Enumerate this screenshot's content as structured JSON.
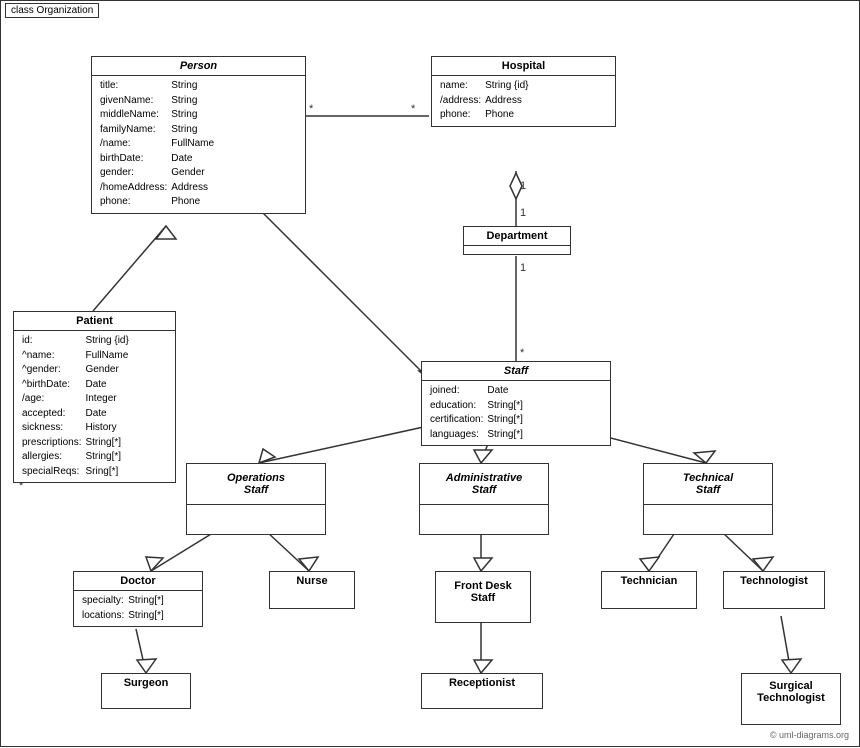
{
  "diagram": {
    "title": "class Organization",
    "classes": {
      "person": {
        "name": "Person",
        "italic": true,
        "attrs": [
          [
            "title:",
            "String"
          ],
          [
            "givenName:",
            "String"
          ],
          [
            "middleName:",
            "String"
          ],
          [
            "familyName:",
            "String"
          ],
          [
            "/name:",
            "FullName"
          ],
          [
            "birthDate:",
            "Date"
          ],
          [
            "gender:",
            "Gender"
          ],
          [
            "/homeAddress:",
            "Address"
          ],
          [
            "phone:",
            "Phone"
          ]
        ]
      },
      "hospital": {
        "name": "Hospital",
        "italic": false,
        "attrs": [
          [
            "name:",
            "String {id}"
          ],
          [
            "/address:",
            "Address"
          ],
          [
            "phone:",
            "Phone"
          ]
        ]
      },
      "department": {
        "name": "Department",
        "italic": false,
        "attrs": []
      },
      "staff": {
        "name": "Staff",
        "italic": true,
        "attrs": [
          [
            "joined:",
            "Date"
          ],
          [
            "education:",
            "String[*]"
          ],
          [
            "certification:",
            "String[*]"
          ],
          [
            "languages:",
            "String[*]"
          ]
        ]
      },
      "patient": {
        "name": "Patient",
        "italic": false,
        "attrs": [
          [
            "id:",
            "String {id}"
          ],
          [
            "^name:",
            "FullName"
          ],
          [
            "^gender:",
            "Gender"
          ],
          [
            "^birthDate:",
            "Date"
          ],
          [
            "/age:",
            "Integer"
          ],
          [
            "accepted:",
            "Date"
          ],
          [
            "sickness:",
            "History"
          ],
          [
            "prescriptions:",
            "String[*]"
          ],
          [
            "allergies:",
            "String[*]"
          ],
          [
            "specialReqs:",
            "Sring[*]"
          ]
        ]
      },
      "operations_staff": {
        "name": "Operations Staff",
        "italic": true
      },
      "administrative_staff": {
        "name": "Administrative Staff",
        "italic": true
      },
      "technical_staff": {
        "name": "Technical Staff",
        "italic": true
      },
      "doctor": {
        "name": "Doctor",
        "italic": false,
        "attrs": [
          [
            "specialty:",
            "String[*]"
          ],
          [
            "locations:",
            "String[*]"
          ]
        ]
      },
      "nurse": {
        "name": "Nurse",
        "italic": false
      },
      "front_desk_staff": {
        "name": "Front Desk Staff",
        "italic": false
      },
      "technician": {
        "name": "Technician",
        "italic": false
      },
      "technologist": {
        "name": "Technologist",
        "italic": false
      },
      "surgeon": {
        "name": "Surgeon",
        "italic": false
      },
      "receptionist": {
        "name": "Receptionist",
        "italic": false
      },
      "surgical_technologist": {
        "name": "Surgical Technologist",
        "italic": false
      }
    },
    "copyright": "© uml-diagrams.org"
  }
}
